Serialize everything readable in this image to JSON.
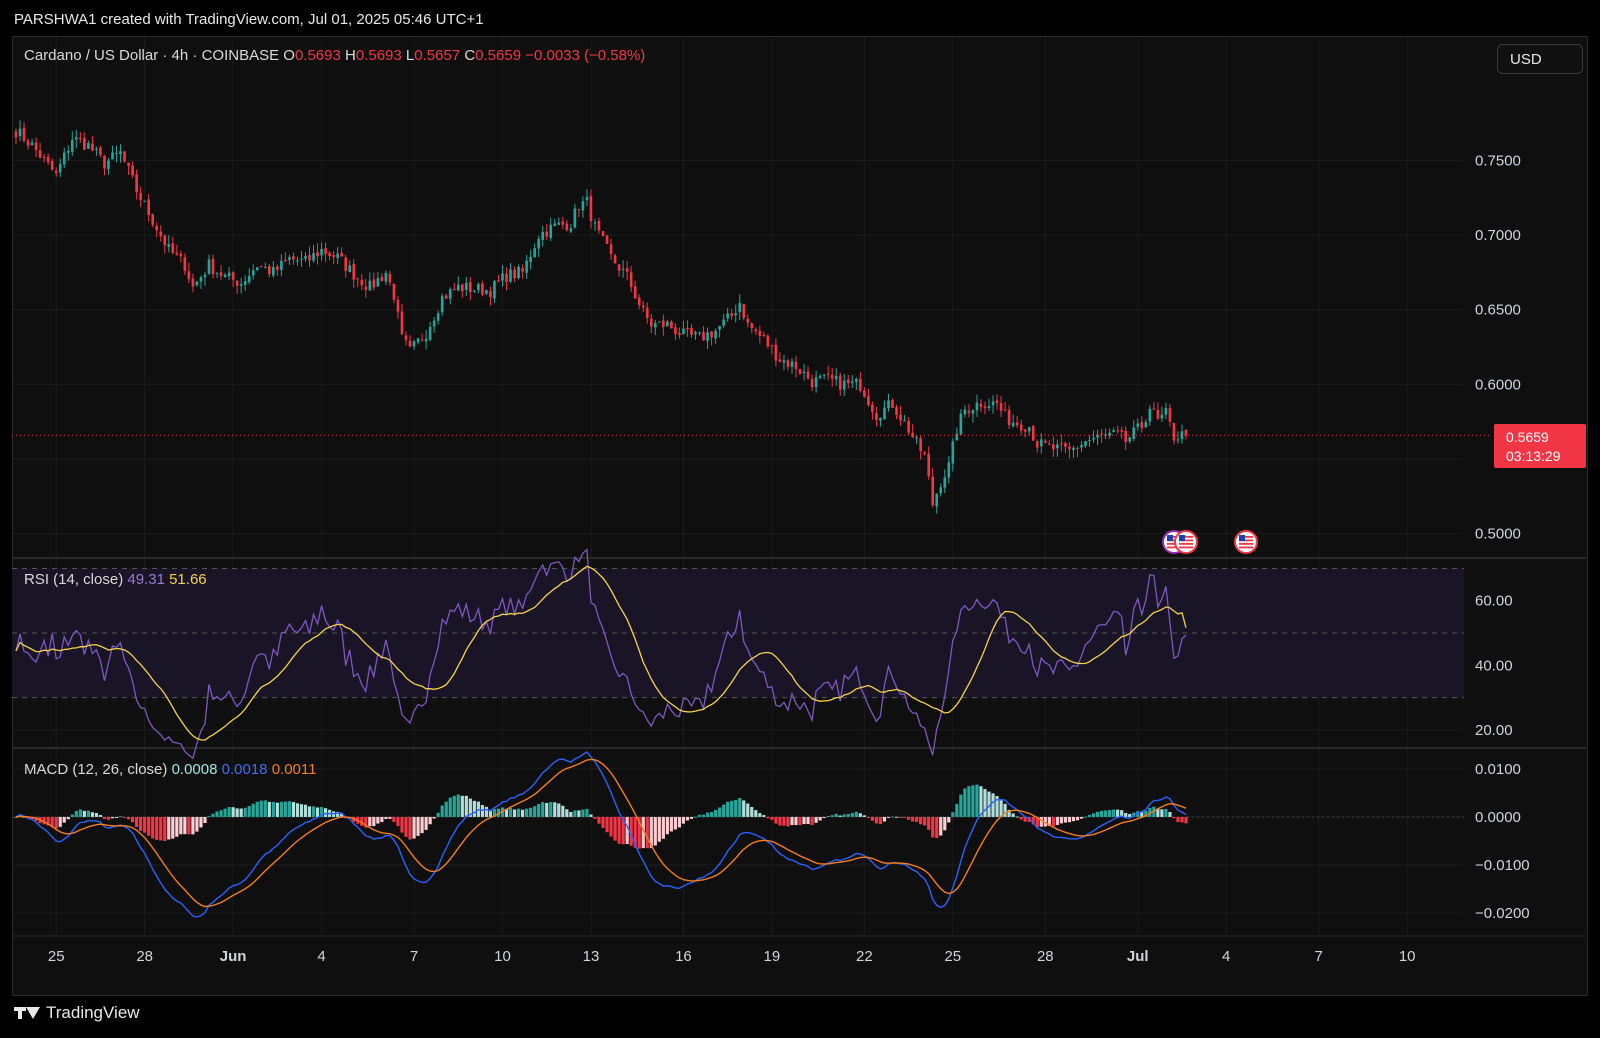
{
  "header": {
    "credit": "PARSHWA1 created with TradingView.com, Jul 01, 2025 05:46 UTC+1"
  },
  "symbol": {
    "title": "Cardano / US Dollar · 4h · COINBASE",
    "o_label": "O",
    "o": "0.5693",
    "h_label": "H",
    "h": "0.5693",
    "l_label": "L",
    "l": "0.5657",
    "c_label": "C",
    "c": "0.5659",
    "change": "−0.0033 (−0.58%)"
  },
  "currency": "USD",
  "last_price": {
    "value": "0.5659",
    "countdown": "03:13:29"
  },
  "rsi_legend": {
    "label": "RSI (14, close)",
    "rsi": "49.31",
    "ma": "51.66"
  },
  "macd_legend": {
    "label": "MACD (12, 26, close)",
    "hist": "0.0008",
    "macd": "0.0018",
    "signal": "0.0011"
  },
  "footer": {
    "brand": "TradingView"
  },
  "colors": {
    "up": "#26a69a",
    "down": "#f23645",
    "rsi": "#7e57c2",
    "rsi_ma": "#f5d24a",
    "macd": "#2962ff",
    "signal": "#f57c1f",
    "hist_up": "#26a69a",
    "hist_down": "#f23645",
    "background": "#0f0f0f"
  },
  "chart_data": [
    {
      "type": "candlestick",
      "title": "Cardano / US Dollar · 4h · COINBASE",
      "x_ticks": [
        "25",
        "28",
        "Jun",
        "4",
        "7",
        "10",
        "13",
        "16",
        "19",
        "22",
        "25",
        "28",
        "Jul",
        "4",
        "7",
        "10"
      ],
      "y_ticks": [
        "0.7500",
        "0.7000",
        "0.6500",
        "0.6000",
        "0.5000"
      ],
      "ylim": [
        0.485,
        0.82
      ],
      "last_close": 0.5659,
      "anchors_close": [
        [
          0,
          0.77
        ],
        [
          4,
          0.76
        ],
        [
          10,
          0.74
        ],
        [
          14,
          0.765
        ],
        [
          18,
          0.76
        ],
        [
          22,
          0.748
        ],
        [
          26,
          0.755
        ],
        [
          30,
          0.73
        ],
        [
          34,
          0.71
        ],
        [
          38,
          0.69
        ],
        [
          42,
          0.68
        ],
        [
          44,
          0.665
        ],
        [
          48,
          0.68
        ],
        [
          52,
          0.672
        ],
        [
          56,
          0.668
        ],
        [
          60,
          0.68
        ],
        [
          64,
          0.675
        ],
        [
          68,
          0.684
        ],
        [
          72,
          0.682
        ],
        [
          76,
          0.69
        ],
        [
          80,
          0.685
        ],
        [
          84,
          0.674
        ],
        [
          88,
          0.665
        ],
        [
          92,
          0.675
        ],
        [
          94,
          0.66
        ],
        [
          96,
          0.63
        ],
        [
          98,
          0.622
        ],
        [
          102,
          0.635
        ],
        [
          106,
          0.658
        ],
        [
          110,
          0.665
        ],
        [
          114,
          0.664
        ],
        [
          118,
          0.663
        ],
        [
          122,
          0.673
        ],
        [
          126,
          0.675
        ],
        [
          130,
          0.7
        ],
        [
          134,
          0.706
        ],
        [
          138,
          0.708
        ],
        [
          140,
          0.72
        ],
        [
          142,
          0.722
        ],
        [
          144,
          0.705
        ],
        [
          148,
          0.685
        ],
        [
          152,
          0.672
        ],
        [
          156,
          0.648
        ],
        [
          158,
          0.64
        ],
        [
          162,
          0.64
        ],
        [
          166,
          0.633
        ],
        [
          170,
          0.631
        ],
        [
          174,
          0.636
        ],
        [
          178,
          0.646
        ],
        [
          180,
          0.655
        ],
        [
          182,
          0.64
        ],
        [
          186,
          0.63
        ],
        [
          190,
          0.617
        ],
        [
          194,
          0.612
        ],
        [
          198,
          0.602
        ],
        [
          202,
          0.603
        ],
        [
          206,
          0.6
        ],
        [
          210,
          0.6
        ],
        [
          214,
          0.58
        ],
        [
          218,
          0.587
        ],
        [
          222,
          0.57
        ],
        [
          224,
          0.56
        ],
        [
          226,
          0.552
        ],
        [
          228,
          0.52
        ],
        [
          230,
          0.535
        ],
        [
          232,
          0.545
        ],
        [
          234,
          0.57
        ],
        [
          236,
          0.583
        ],
        [
          240,
          0.588
        ],
        [
          244,
          0.587
        ],
        [
          246,
          0.578
        ],
        [
          248,
          0.575
        ],
        [
          252,
          0.572
        ],
        [
          254,
          0.56
        ],
        [
          258,
          0.557
        ],
        [
          262,
          0.555
        ],
        [
          266,
          0.562
        ],
        [
          270,
          0.565
        ],
        [
          274,
          0.566
        ],
        [
          276,
          0.562
        ],
        [
          280,
          0.572
        ],
        [
          282,
          0.585
        ],
        [
          284,
          0.575
        ],
        [
          286,
          0.58
        ],
        [
          288,
          0.565
        ],
        [
          290,
          0.5659
        ]
      ]
    },
    {
      "type": "line",
      "title": "RSI (14, close)",
      "series": [
        {
          "name": "RSI",
          "last": 49.31
        },
        {
          "name": "RSI MA",
          "last": 51.66
        }
      ],
      "bands": [
        70,
        50,
        30
      ],
      "y_ticks": [
        "60.00",
        "40.00",
        "20.00"
      ],
      "ylim": [
        15,
        72
      ]
    },
    {
      "type": "line",
      "title": "MACD (12, 26, close)",
      "series": [
        {
          "name": "Histogram",
          "last": 0.0008
        },
        {
          "name": "MACD",
          "last": 0.0018
        },
        {
          "name": "Signal",
          "last": 0.0011
        }
      ],
      "y_ticks": [
        "0.0100",
        "0.0000",
        "−0.0100",
        "−0.0200"
      ],
      "ylim": [
        -0.0235,
        0.0135
      ]
    }
  ]
}
